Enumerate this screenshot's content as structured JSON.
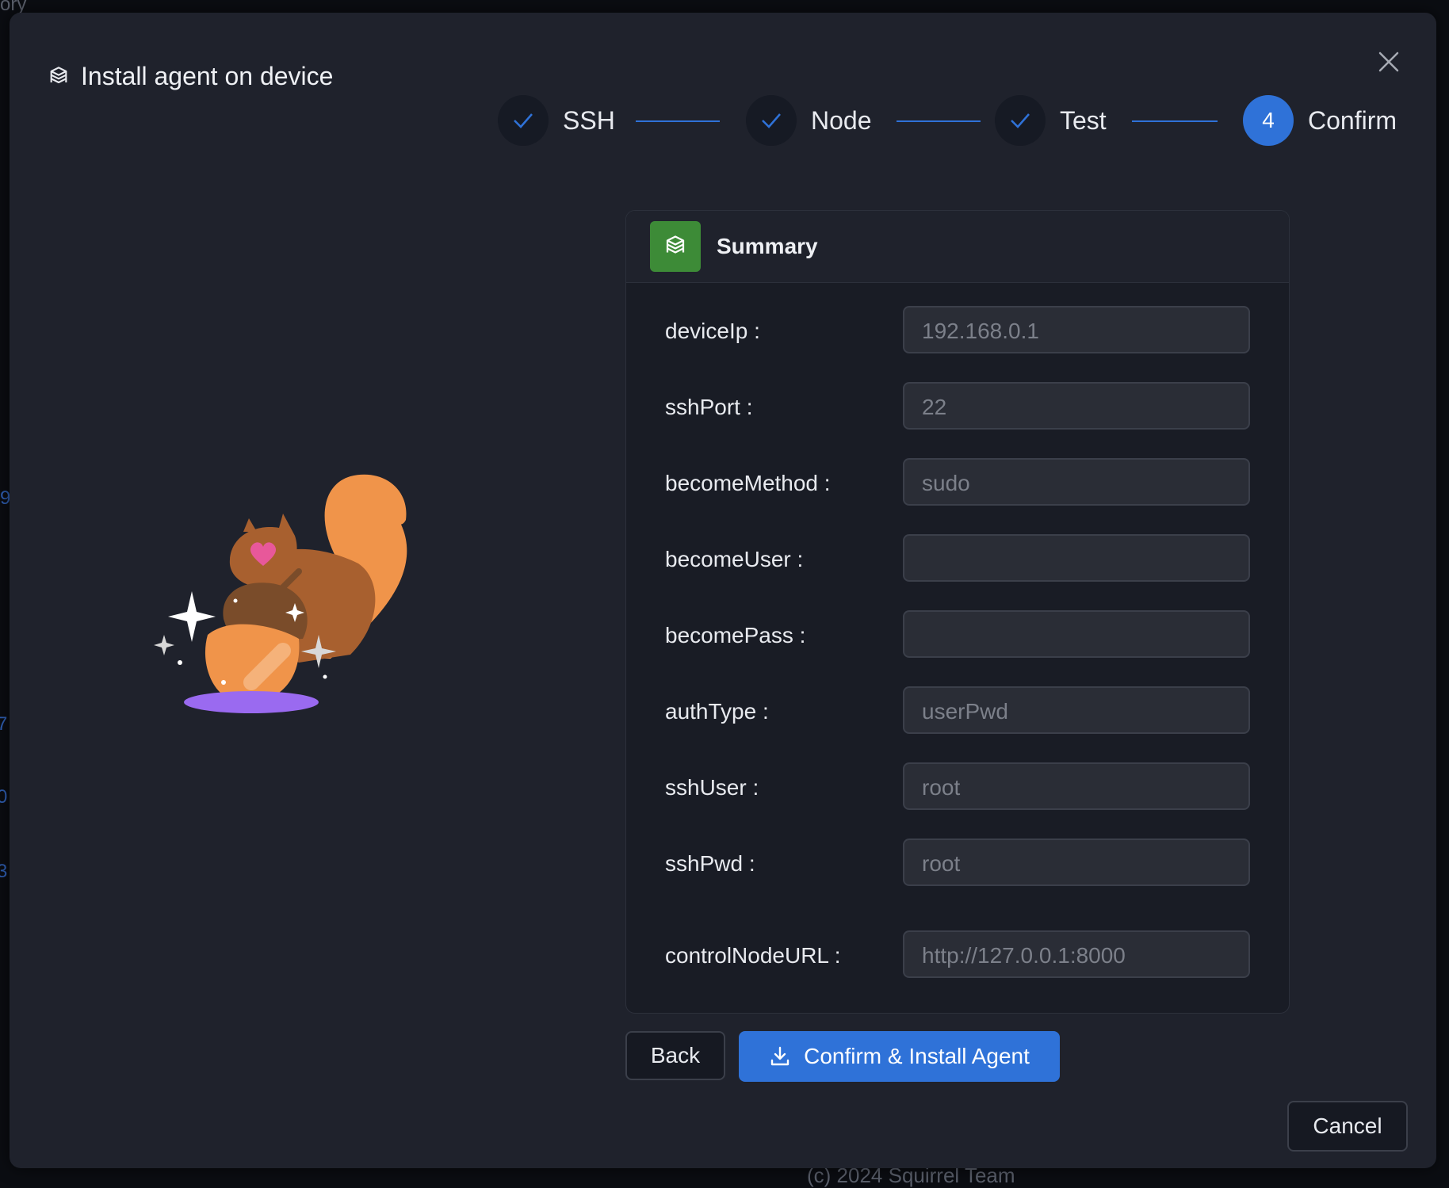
{
  "background": {
    "top_text": "ory",
    "side_links": [
      "9",
      "7",
      "0",
      "3"
    ],
    "footer": "(c) 2024 Squirrel Team"
  },
  "modal": {
    "title": "Install agent on device",
    "title_icon": "package-icon",
    "close_icon": "close-icon"
  },
  "steps": [
    {
      "label": "SSH",
      "status": "done"
    },
    {
      "label": "Node",
      "status": "done"
    },
    {
      "label": "Test",
      "status": "done"
    },
    {
      "label": "Confirm",
      "status": "active",
      "number": "4"
    }
  ],
  "summary": {
    "title": "Summary",
    "fields": [
      {
        "label": "deviceIp :",
        "value": "192.168.0.1"
      },
      {
        "label": "sshPort :",
        "value": "22"
      },
      {
        "label": "becomeMethod :",
        "value": "sudo"
      },
      {
        "label": "becomeUser :",
        "value": ""
      },
      {
        "label": "becomePass :",
        "value": ""
      },
      {
        "label": "authType :",
        "value": "userPwd"
      },
      {
        "label": "sshUser :",
        "value": "root"
      },
      {
        "label": "sshPwd :",
        "value": "root"
      },
      {
        "label": "controlNodeURL :",
        "value": "http://127.0.0.1:8000"
      }
    ]
  },
  "buttons": {
    "back": "Back",
    "confirm": "Confirm & Install Agent",
    "cancel": "Cancel"
  },
  "colors": {
    "accent": "#2f72d8",
    "summary_icon_bg": "#3d8b37",
    "modal_bg": "#1f222c"
  }
}
